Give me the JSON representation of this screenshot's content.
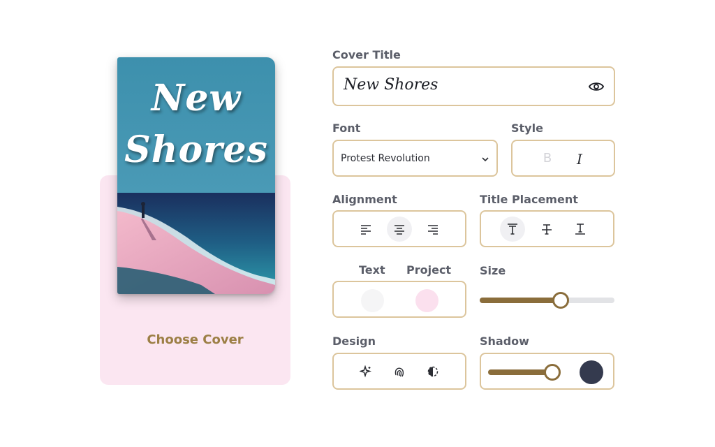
{
  "cover": {
    "title_line1": "New",
    "title_line2": "Shores",
    "choose_label": "Choose Cover"
  },
  "form": {
    "cover_title_label": "Cover Title",
    "cover_title_value": "New Shores",
    "font_label": "Font",
    "font_value": "Protest Revolution",
    "style_label": "Style",
    "bold_glyph": "B",
    "italic_glyph": "I",
    "alignment_label": "Alignment",
    "title_placement_label": "Title Placement",
    "text_label": "Text",
    "project_label": "Project",
    "size_label": "Size",
    "size_value": 0.6,
    "design_label": "Design",
    "shadow_label": "Shadow",
    "shadow_value": 0.92
  },
  "colors": {
    "accent": "#8a6d3b",
    "border": "#dcc59c",
    "text_swatch": "#f5f5f6",
    "project_swatch": "#fbe0ee",
    "shadow_swatch": "#343a4e",
    "choose_cover": "#9c7f45"
  },
  "icons": {
    "visibility": "eye-icon",
    "dropdown": "chevron-down-icon",
    "align_left": "align-left-icon",
    "align_center": "align-center-icon",
    "align_right": "align-right-icon",
    "placement_top": "title-top-icon",
    "placement_middle": "title-middle-icon",
    "placement_bottom": "title-bottom-icon",
    "design_1": "sparkles-icon",
    "design_2": "fingerprint-icon",
    "design_3": "contrast-icon"
  }
}
